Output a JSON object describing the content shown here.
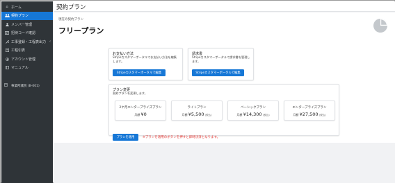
{
  "sidebar": {
    "items": [
      {
        "icon": "home-icon",
        "label": "ホーム"
      },
      {
        "icon": "users-icon",
        "label": "契約プラン"
      },
      {
        "icon": "user-icon",
        "label": "メンバー管理"
      },
      {
        "icon": "card-icon",
        "label": "招待コード確認"
      },
      {
        "icon": "tools-icon",
        "label": "工事登録・工程表出力"
      },
      {
        "icon": "list-icon",
        "label": "工程引表"
      },
      {
        "icon": "user-circle-icon",
        "label": "アカウント管理"
      },
      {
        "icon": "book-icon",
        "label": "マニュアル"
      }
    ],
    "office": "事業所識別 (B-001)"
  },
  "header": {
    "title": "契約プラン"
  },
  "main": {
    "current_label": "現在の契約プラン",
    "plan_name": "フリープラン",
    "payment_card": {
      "title": "お支払い方法",
      "description": "Stripeカスタマーポータルでお支払い方法を編集します。",
      "button": "Stripeカスタマーポータルで編集"
    },
    "invoice_card": {
      "title": "請求書",
      "description": "Stripeカスタマーポータルで請求書を管理します。",
      "button": "Stripeカスタマーポータルで編集"
    },
    "change_card": {
      "title": "プラン変更",
      "subtitle": "契約プランを変更します。",
      "plans": [
        {
          "name": "2ケ月エンタープライズプラン",
          "prefix": "月額",
          "price": "¥0",
          "tax": ""
        },
        {
          "name": "ライトプラン",
          "prefix": "月額",
          "price": "¥5,500",
          "tax": "(税込)"
        },
        {
          "name": "ベーシックプラン",
          "prefix": "月額",
          "price": "¥14,300",
          "tax": "(税込)"
        },
        {
          "name": "エンタープライズプラン",
          "prefix": "月額",
          "price": "¥27,500",
          "tax": "(税込)"
        }
      ],
      "apply_button": "プランを適用",
      "note": "※プランを適用のボタンを押すと即時決済となります。"
    }
  },
  "colors": {
    "sidebar": "#2f3438",
    "accent": "#1677d6",
    "warning": "#e53935"
  }
}
